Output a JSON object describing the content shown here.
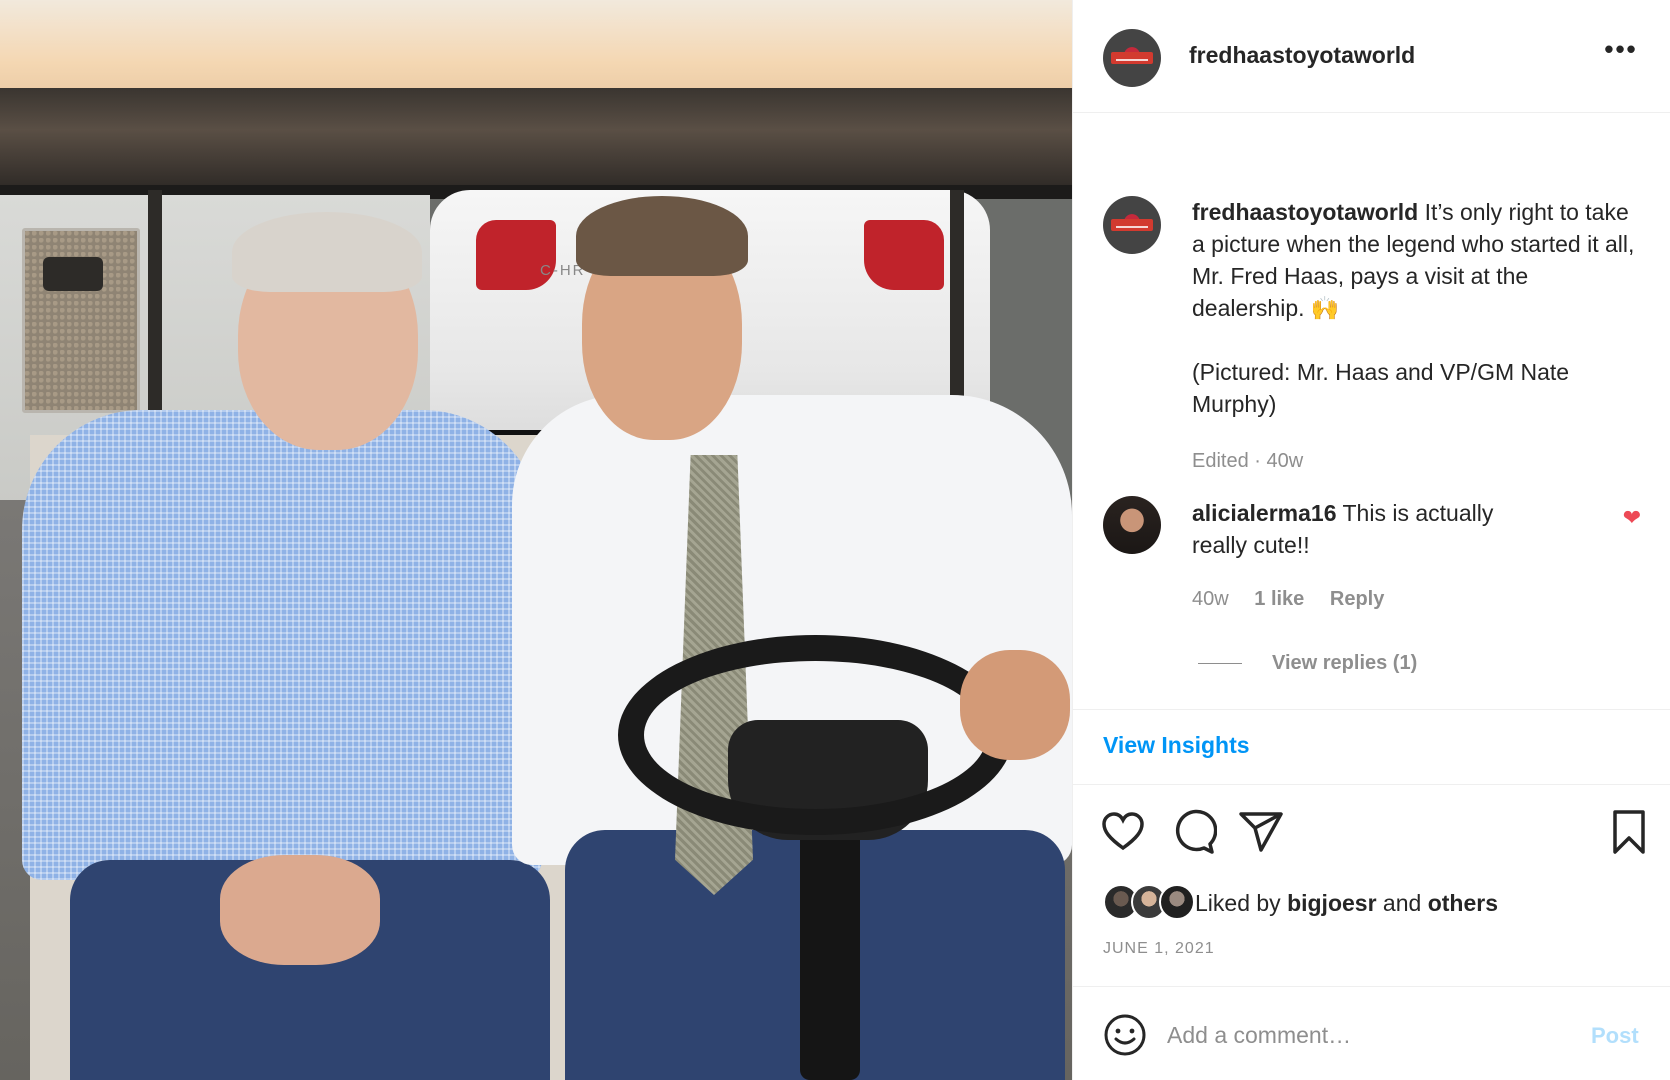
{
  "post": {
    "username": "fredhaastoyotaworld",
    "more_label": "•••"
  },
  "caption": {
    "username": "fredhaastoyotaworld",
    "text": "It’s only right to take a picture when the legend who started it all, Mr. Fred Haas, pays a visit at the dealership. 🙌",
    "text2": "(Pictured: Mr. Haas and VP/GM Nate Murphy)",
    "meta": "Edited · 40w"
  },
  "comment": {
    "username": "alicialerma16",
    "text": "This is actually really cute!!",
    "age": "40w",
    "likes": "1 like",
    "reply_label": "Reply",
    "view_replies": "View replies (1)",
    "liked": true
  },
  "insights": {
    "label": "View Insights"
  },
  "actions": {
    "icons": [
      "heart-icon",
      "comment-icon",
      "share-icon",
      "bookmark-icon"
    ],
    "liked_by_prefix": "Liked by",
    "liked_by_user": "bigjoesr",
    "liked_by_and": "and",
    "liked_by_others": "others",
    "date": "JUNE 1, 2021"
  },
  "add_comment": {
    "placeholder": "Add a comment…",
    "post_label": "Post"
  },
  "colors": {
    "link_blue": "#0095f6",
    "post_disabled": "#b2dffc",
    "heart_red": "#ed4956",
    "muted_text": "#8e8e8e"
  }
}
